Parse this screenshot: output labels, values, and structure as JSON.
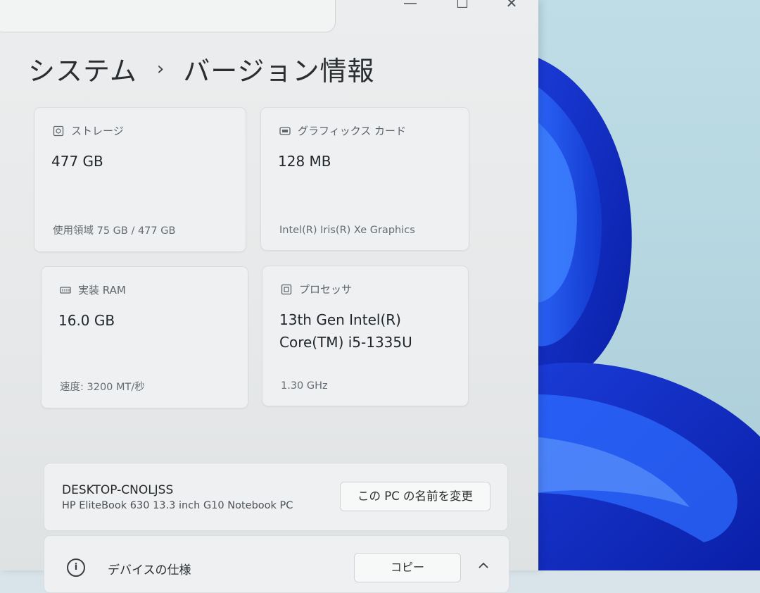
{
  "window": {
    "minimize": "—",
    "maximize": "☐",
    "close": "✕"
  },
  "breadcrumb": {
    "parent": "システム",
    "separator": "›",
    "current": "バージョン情報"
  },
  "cards": {
    "storage": {
      "label": "ストレージ",
      "value": "477 GB",
      "sub": "使用領域 75 GB / 477 GB",
      "icon": "storage-icon"
    },
    "graphics": {
      "label": "グラフィックス カード",
      "value": "128 MB",
      "sub": "Intel(R) Iris(R) Xe Graphics",
      "icon": "graphics-card-icon"
    },
    "ram": {
      "label": "実装 RAM",
      "value": "16.0 GB",
      "sub": "速度: 3200 MT/秒",
      "icon": "ram-icon"
    },
    "processor": {
      "label": "プロセッサ",
      "value_line1": "13th Gen Intel(R)",
      "value_line2": "Core(TM) i5-1335U",
      "sub": "1.30 GHz",
      "icon": "processor-icon"
    }
  },
  "device": {
    "name": "DESKTOP-CNOLJSS",
    "model": "HP EliteBook 630 13.3 inch G10 Notebook PC",
    "rename_label": "この PC の名前を変更"
  },
  "specs": {
    "title": "デバイスの仕様",
    "copy_label": "コピー"
  }
}
